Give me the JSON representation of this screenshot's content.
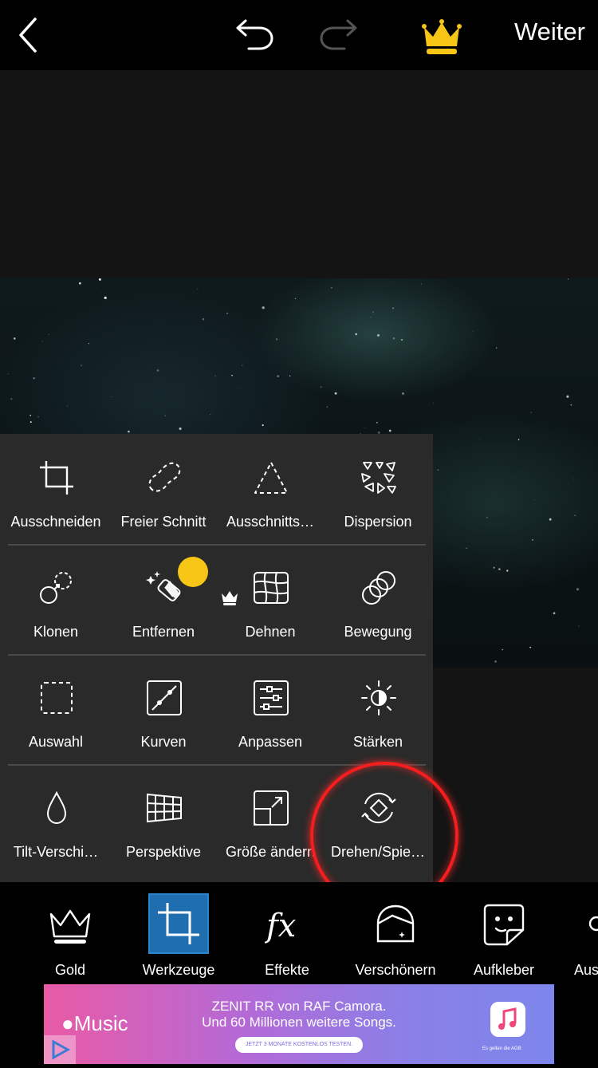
{
  "topbar": {
    "back_icon": "chevron-left-icon",
    "undo_icon": "undo-icon",
    "redo_icon": "redo-icon",
    "premium_icon": "crown-icon",
    "next_label": "Weiter",
    "accent_color": "#f6c515"
  },
  "tools_menu": {
    "rows": [
      [
        {
          "label": "Ausschneiden",
          "icon": "crop-icon"
        },
        {
          "label": "Freier Schnitt",
          "icon": "free-crop-icon"
        },
        {
          "label": "Ausschnitts…",
          "icon": "shape-crop-icon"
        },
        {
          "label": "Dispersion",
          "icon": "dispersion-icon"
        }
      ],
      [
        {
          "label": "Klonen",
          "icon": "clone-icon"
        },
        {
          "label": "Entfernen",
          "icon": "remove-icon",
          "premium": true
        },
        {
          "label": "Dehnen",
          "icon": "stretch-icon"
        },
        {
          "label": "Bewegung",
          "icon": "motion-icon"
        }
      ],
      [
        {
          "label": "Auswahl",
          "icon": "selection-icon"
        },
        {
          "label": "Kurven",
          "icon": "curves-icon"
        },
        {
          "label": "Anpassen",
          "icon": "adjust-icon"
        },
        {
          "label": "Stärken",
          "icon": "enhance-icon"
        }
      ],
      [
        {
          "label": "Tilt-Verschi…",
          "icon": "tilt-shift-icon"
        },
        {
          "label": "Perspektive",
          "icon": "perspective-icon"
        },
        {
          "label": "Größe ändern",
          "icon": "resize-icon"
        },
        {
          "label": "Drehen/Spie…",
          "icon": "rotate-flip-icon"
        }
      ]
    ],
    "background": "#2a2a2a"
  },
  "bottom_tabs": [
    {
      "label": "Gold",
      "icon": "crown-outline-icon"
    },
    {
      "label": "Werkzeuge",
      "icon": "crop-tool-icon",
      "active": true
    },
    {
      "label": "Effekte",
      "icon": "fx-icon"
    },
    {
      "label": "Verschönern",
      "icon": "beautify-icon"
    },
    {
      "label": "Aufkleber",
      "icon": "sticker-icon"
    },
    {
      "label": "Aus",
      "icon": "cutout-icon"
    }
  ],
  "active_tab_color": "#1f6fb0",
  "ad": {
    "brand": "Music",
    "line1": "ZENIT RR von RAF Camora.",
    "line2": "Und 60 Millionen weitere Songs.",
    "cta": "JETZT 3 MONATE KOSTENLOS TESTEN.",
    "footnote": "Es gelten die AGB"
  },
  "highlight_color": "#f51d1d"
}
